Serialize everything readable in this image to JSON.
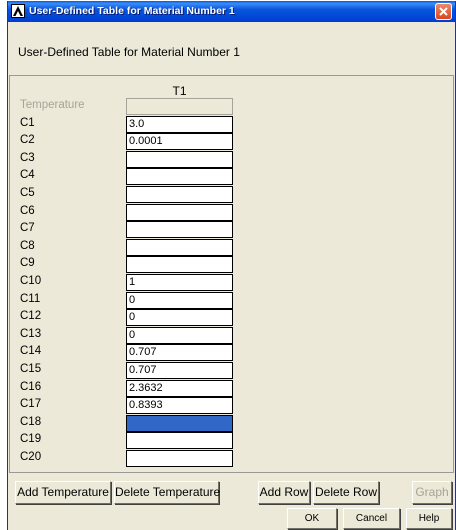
{
  "window": {
    "title": "User-Defined Table for Material Number 1"
  },
  "heading": "User-Defined Table  for Material Number 1",
  "table": {
    "column_header": "T1",
    "rows": [
      {
        "label": "Temperature",
        "value": ""
      },
      {
        "label": "C1",
        "value": "3.0"
      },
      {
        "label": "C2",
        "value": "0.0001"
      },
      {
        "label": "C3",
        "value": ""
      },
      {
        "label": "C4",
        "value": ""
      },
      {
        "label": "C5",
        "value": ""
      },
      {
        "label": "C6",
        "value": ""
      },
      {
        "label": "C7",
        "value": ""
      },
      {
        "label": "C8",
        "value": ""
      },
      {
        "label": "C9",
        "value": ""
      },
      {
        "label": "C10",
        "value": "1"
      },
      {
        "label": "C11",
        "value": "0"
      },
      {
        "label": "C12",
        "value": "0"
      },
      {
        "label": "C13",
        "value": "0"
      },
      {
        "label": "C14",
        "value": "0.707"
      },
      {
        "label": "C15",
        "value": "0.707"
      },
      {
        "label": "C16",
        "value": "2.3632"
      },
      {
        "label": "C17",
        "value": "0.8393"
      },
      {
        "label": "C18",
        "value": ""
      },
      {
        "label": "C19",
        "value": ""
      },
      {
        "label": "C20",
        "value": ""
      }
    ],
    "selected_row": "C18"
  },
  "buttons": {
    "add_temperature": "Add Temperature",
    "delete_temperature": "Delete Temperature",
    "add_row": "Add Row",
    "delete_row": "Delete Row",
    "graph": "Graph",
    "ok": "OK",
    "cancel": "Cancel",
    "help": "Help"
  },
  "colors": {
    "titlebar": "#0054e3",
    "dialog_bg": "#ece9d8",
    "selection": "#3168c8",
    "disabled_text": "#a6a398"
  }
}
